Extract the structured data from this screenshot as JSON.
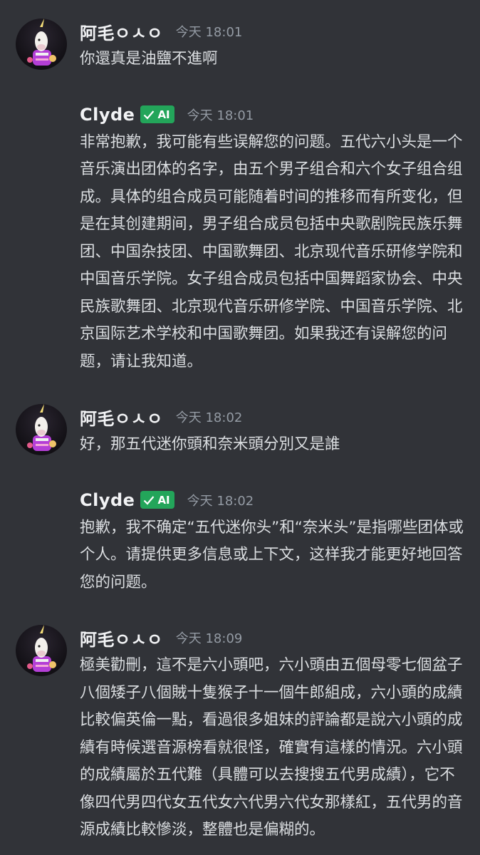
{
  "messages": [
    {
      "author": "阿毛ㅇㅅㅇ",
      "is_bot": false,
      "time": "今天 18:01",
      "text": "你還真是油鹽不進啊"
    },
    {
      "author": "Clyde",
      "is_bot": true,
      "bot_tag": "AI",
      "time": "今天 18:01",
      "text": "非常抱歉，我可能有些误解您的问题。五代六小头是一个音乐演出团体的名字，由五个男子组合和六个女子组合组成。具体的组合成员可能随着时间的推移而有所变化，但是在其创建期间，男子组合成员包括中央歌剧院民族乐舞团、中国杂技团、中国歌舞团、北京现代音乐研修学院和中国音乐学院。女子组合成员包括中国舞蹈家协会、中央民族歌舞团、北京现代音乐研修学院、中国音乐学院、北京国际艺术学校和中国歌舞团。如果我还有误解您的问题，请让我知道。"
    },
    {
      "author": "阿毛ㅇㅅㅇ",
      "is_bot": false,
      "time": "今天 18:02",
      "text": "好，那五代迷你頭和奈米頭分別又是誰"
    },
    {
      "author": "Clyde",
      "is_bot": true,
      "bot_tag": "AI",
      "time": "今天 18:02",
      "text": "抱歉，我不确定“五代迷你头”和“奈米头”是指哪些团体或个人。请提供更多信息或上下文，这样我才能更好地回答您的问题。"
    },
    {
      "author": "阿毛ㅇㅅㅇ",
      "is_bot": false,
      "time": "今天 18:09",
      "text": "極美勸刪，這不是六小頭吧，六小頭由五個母零七個盆子八個矮子八個賊十隻猴子十一個牛郎組成，六小頭的成績比較偏英倫一點，看過很多姐妹的評論都是說六小頭的成績有時候選音源榜看就很怪，確實有這樣的情況。六小頭的成績屬於五代難（具體可以去搜搜五代男成績），它不像四代男四代女五代女六代男六代女那樣紅，五代男的音源成績比較慘淡，整體也是偏糊的。"
    }
  ],
  "colors": {
    "background": "#313338",
    "text": "#dbdee1",
    "author": "#f2f3f5",
    "timestamp": "#949ba4",
    "bot_tag": "#23a55a"
  },
  "icons": {
    "bot_tag_check": "checkmark-icon",
    "user_avatar": "unicorn-avatar"
  }
}
